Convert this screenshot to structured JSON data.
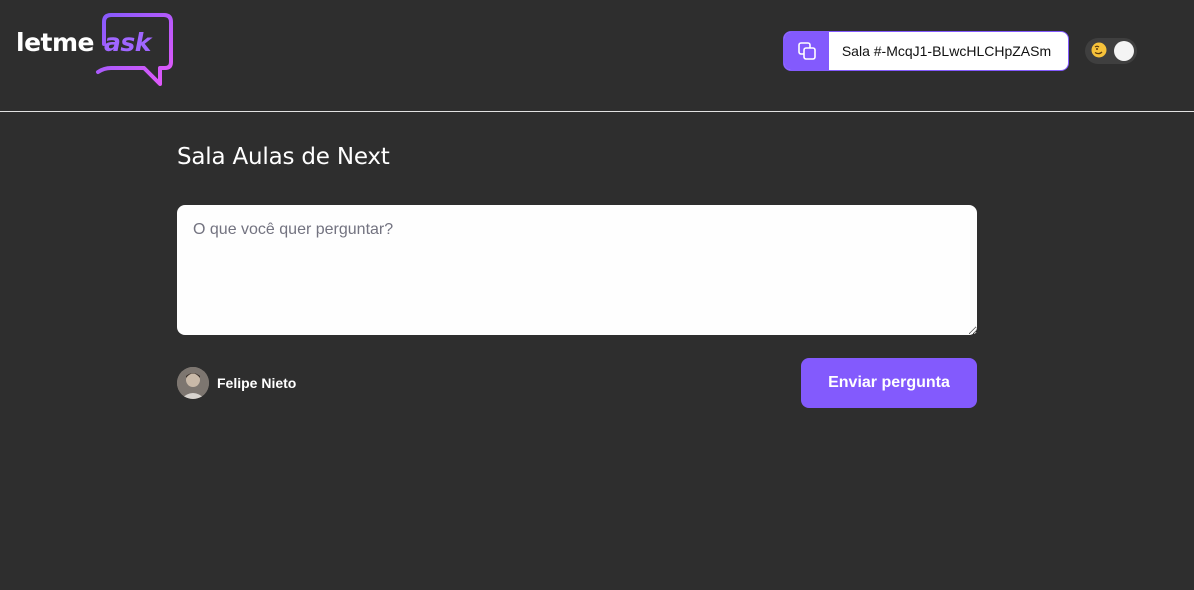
{
  "logo": {
    "text_primary": "letme",
    "text_accent": "ask",
    "accent_colors": [
      "#835afd",
      "#e559f9"
    ]
  },
  "header": {
    "room_code": {
      "icon": "copy-icon",
      "label": "Sala #-McqJ1-BLwcHLCHpZASm"
    },
    "theme_toggle": {
      "icon": "emoji-icon",
      "state": "on"
    }
  },
  "main": {
    "room_title": "Sala Aulas de Next",
    "question": {
      "placeholder": "O que você quer perguntar?",
      "value": ""
    },
    "user": {
      "name": "Felipe Nieto"
    },
    "send_button_label": "Enviar pergunta"
  },
  "colors": {
    "background": "#2e2e2e",
    "accent": "#835afd",
    "text": "#ffffff"
  }
}
